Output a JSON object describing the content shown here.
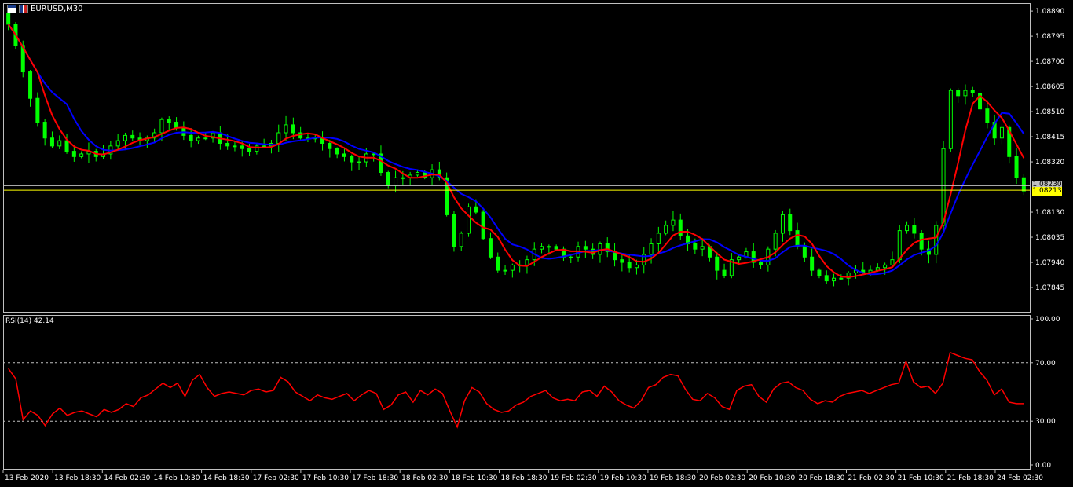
{
  "window": {
    "symbol_label": "EURUSD,M30",
    "rsi_label": "RSI(14) 42.14"
  },
  "price_tags": {
    "current_price": "1.08213",
    "ask_price": "1.08230",
    "current_bg": "#ffff00",
    "ask_bg": "#c0c0c0"
  },
  "colors": {
    "background": "#000000",
    "candle": "#00ff00",
    "ma_fast": "#ff0000",
    "ma_slow": "#0000ff",
    "rsi_line": "#ff0000",
    "bid_line": "#ffff00",
    "ask_line": "#c0c0c0",
    "grid_dash": "#c0c0c0"
  },
  "chart_data": [
    {
      "type": "candlestick",
      "title": "EURUSD,M30",
      "grid": false,
      "ylim": [
        1.0775,
        1.0892
      ],
      "y_ticks": [
        "1.08890",
        "1.08795",
        "1.08700",
        "1.08605",
        "1.08510",
        "1.08415",
        "1.08320",
        "1.08130",
        "1.08035",
        "1.07940",
        "1.07845"
      ],
      "x_ticks": [
        "13 Feb 2020",
        "13 Feb 18:30",
        "14 Feb 02:30",
        "14 Feb 10:30",
        "14 Feb 18:30",
        "17 Feb 02:30",
        "17 Feb 10:30",
        "17 Feb 18:30",
        "18 Feb 02:30",
        "18 Feb 10:30",
        "18 Feb 18:30",
        "19 Feb 02:30",
        "19 Feb 10:30",
        "19 Feb 18:30",
        "20 Feb 02:30",
        "20 Feb 10:30",
        "20 Feb 18:30",
        "21 Feb 02:30",
        "21 Feb 10:30",
        "21 Feb 18:30",
        "24 Feb 02:30"
      ],
      "bid": 1.08213,
      "ask": 1.0823,
      "close_series": [
        1.0884,
        1.0876,
        1.0866,
        1.0856,
        1.0847,
        1.0841,
        1.0838,
        1.084,
        1.0836,
        1.0834,
        1.0835,
        1.0836,
        1.0834,
        1.0835,
        1.0838,
        1.084,
        1.0842,
        1.0841,
        1.084,
        1.0841,
        1.0843,
        1.0848,
        1.0847,
        1.0845,
        1.0842,
        1.084,
        1.0841,
        1.0841,
        1.0843,
        1.0839,
        1.0838,
        1.0838,
        1.0837,
        1.0836,
        1.0838,
        1.0838,
        1.0839,
        1.0843,
        1.0846,
        1.0843,
        1.0841,
        1.0841,
        1.0841,
        1.0839,
        1.0837,
        1.0835,
        1.0834,
        1.0832,
        1.0832,
        1.0835,
        1.0835,
        1.0828,
        1.0823,
        1.0826,
        1.0826,
        1.0827,
        1.0828,
        1.0826,
        1.0829,
        1.0826,
        1.0812,
        1.08,
        1.0805,
        1.0815,
        1.0813,
        1.0803,
        1.0796,
        1.0791,
        1.0791,
        1.0793,
        1.0793,
        1.0795,
        1.0799,
        1.08,
        1.08,
        1.0799,
        1.0796,
        1.0796,
        1.08,
        1.0799,
        1.0797,
        1.0801,
        1.0798,
        1.0795,
        1.0794,
        1.0792,
        1.0793,
        1.0797,
        1.0801,
        1.0805,
        1.0808,
        1.081,
        1.0804,
        1.0801,
        1.0799,
        1.08,
        1.0796,
        1.0791,
        1.0789,
        1.0795,
        1.0796,
        1.0798,
        1.0794,
        1.0793,
        1.0799,
        1.0805,
        1.0812,
        1.0806,
        1.08,
        1.0796,
        1.0791,
        1.0789,
        1.0787,
        1.0788,
        1.0788,
        1.079,
        1.0791,
        1.079,
        1.0791,
        1.0792,
        1.0793,
        1.0795,
        1.0806,
        1.0808,
        1.0805,
        1.0799,
        1.0797,
        1.0808,
        1.0837,
        1.0859,
        1.0857,
        1.0859,
        1.0858,
        1.0852,
        1.0847,
        1.0841,
        1.0845,
        1.0834,
        1.0826,
        1.0821
      ],
      "series": [
        {
          "name": "",
          "color": "#ff0000",
          "kind": "moving-average-fast"
        },
        {
          "name": "",
          "color": "#0000ff",
          "kind": "moving-average-slow"
        }
      ]
    },
    {
      "type": "line",
      "title": "RSI(14) 42.14",
      "ylim": [
        0,
        100
      ],
      "y_ticks": [
        "100.00",
        "70.00",
        "30.00",
        "0.00"
      ],
      "levels": [
        70,
        30
      ],
      "series": [
        {
          "name": "RSI(14)",
          "color": "#ff0000",
          "values": [
            66,
            59,
            31,
            37,
            34,
            27,
            35,
            39,
            34,
            36,
            37,
            35,
            33,
            38,
            36,
            38,
            42,
            40,
            46,
            48,
            52,
            56,
            53,
            56,
            47,
            58,
            62,
            53,
            47,
            49,
            50,
            49,
            48,
            51,
            52,
            50,
            51,
            60,
            57,
            50,
            47,
            44,
            48,
            46,
            45,
            47,
            49,
            44,
            48,
            51,
            49,
            38,
            41,
            48,
            50,
            43,
            51,
            48,
            52,
            49,
            37,
            26,
            44,
            53,
            50,
            42,
            38,
            36,
            37,
            41,
            43,
            47,
            49,
            51,
            46,
            44,
            45,
            44,
            50,
            51,
            47,
            54,
            50,
            44,
            41,
            39,
            44,
            53,
            55,
            60,
            62,
            61,
            52,
            45,
            44,
            49,
            46,
            40,
            38,
            51,
            54,
            55,
            47,
            43,
            52,
            56,
            57,
            53,
            51,
            45,
            42,
            44,
            43,
            47,
            49,
            50,
            51,
            49,
            51,
            53,
            55,
            56,
            71,
            57,
            53,
            54,
            49,
            56,
            77,
            75,
            73,
            72,
            64,
            58,
            48,
            52,
            43,
            42,
            42
          ]
        }
      ]
    }
  ]
}
